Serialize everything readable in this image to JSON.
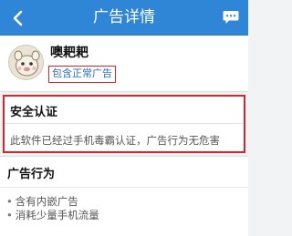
{
  "header": {
    "title": "广告详情",
    "back_icon": "back-arrow-icon",
    "message_icon": "message-bubble-icon",
    "color": "#2f86d6"
  },
  "app": {
    "name": "噢耙耙",
    "tag": "包含正常广告",
    "avatar_icon": "app-avatar-icon"
  },
  "security": {
    "title": "安全认证",
    "text": "此软件已经过手机毒霸认证，广告行为无危害",
    "highlight_color": "#d9242c"
  },
  "behavior": {
    "title": "广告行为",
    "items": [
      "含有内嵌广告",
      "消耗少量手机流量"
    ]
  }
}
